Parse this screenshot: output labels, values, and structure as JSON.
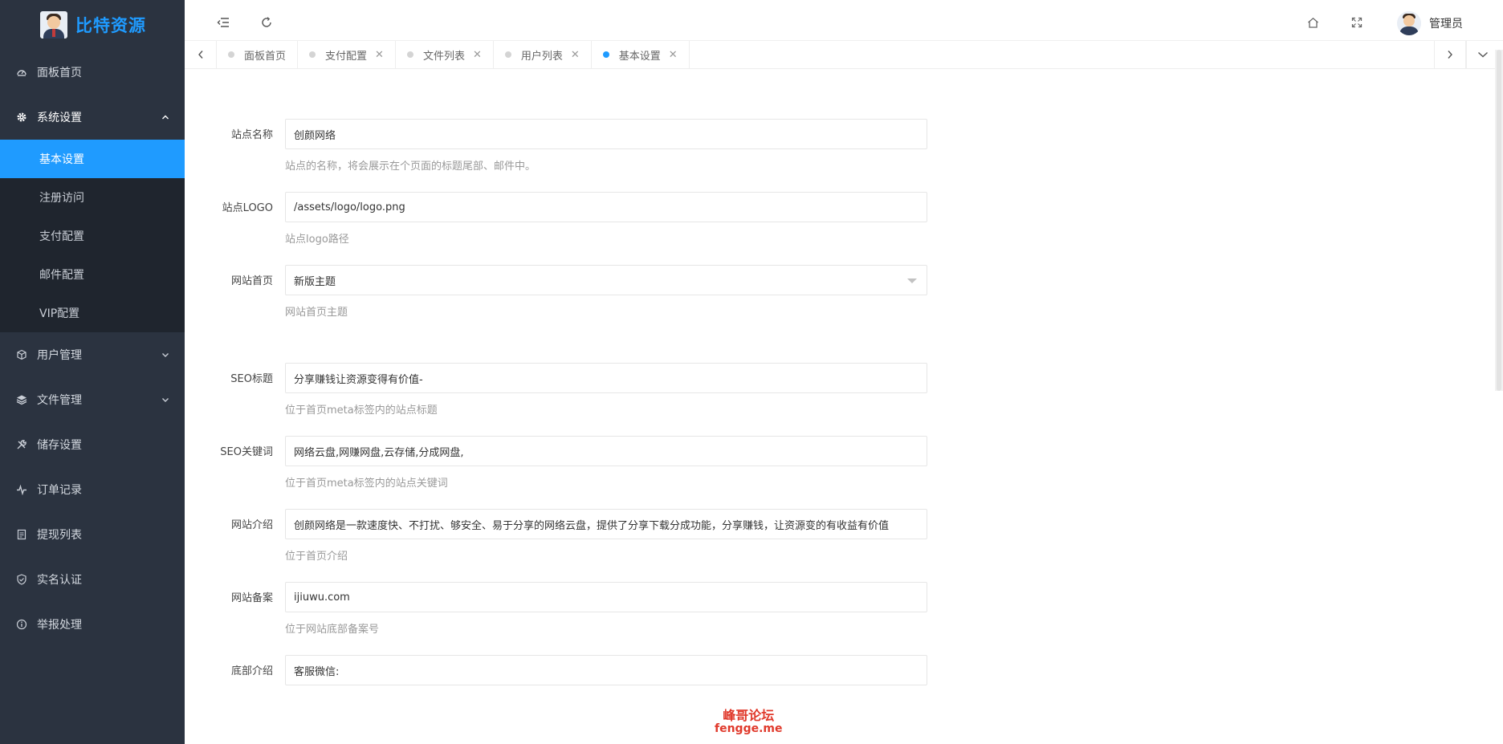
{
  "brand": {
    "name": "比特资源"
  },
  "sidebar": {
    "items": [
      {
        "label": "面板首页",
        "icon": "dashboard-icon"
      },
      {
        "label": "系统设置",
        "icon": "gear-icon",
        "open": true,
        "children": [
          {
            "label": "基本设置",
            "active": true
          },
          {
            "label": "注册访问"
          },
          {
            "label": "支付配置"
          },
          {
            "label": "邮件配置"
          },
          {
            "label": "VIP配置"
          }
        ]
      },
      {
        "label": "用户管理",
        "icon": "cube-icon"
      },
      {
        "label": "文件管理",
        "icon": "layers-icon"
      },
      {
        "label": "储存设置",
        "icon": "tools-icon"
      },
      {
        "label": "订单记录",
        "icon": "pulse-icon"
      },
      {
        "label": "提现列表",
        "icon": "list-icon"
      },
      {
        "label": "实名认证",
        "icon": "shield-check-icon"
      },
      {
        "label": "举报处理",
        "icon": "info-icon"
      }
    ]
  },
  "header": {
    "user_name": "管理员",
    "icons": [
      "menu-fold-icon",
      "refresh-icon",
      "home-icon",
      "fullscreen-icon"
    ]
  },
  "tabs": [
    {
      "label": "面板首页",
      "closable": false
    },
    {
      "label": "支付配置",
      "closable": true
    },
    {
      "label": "文件列表",
      "closable": true
    },
    {
      "label": "用户列表",
      "closable": true
    },
    {
      "label": "基本设置",
      "closable": true,
      "active": true
    }
  ],
  "form": {
    "site_name": {
      "label": "站点名称",
      "value": "创颜网络",
      "help": "站点的名称，将会展示在个页面的标题尾部、邮件中。"
    },
    "site_logo": {
      "label": "站点LOGO",
      "value": "/assets/logo/logo.png",
      "help": "站点logo路径"
    },
    "home_theme": {
      "label": "网站首页",
      "value": "新版主题",
      "help": "网站首页主题"
    },
    "seo_title": {
      "label": "SEO标题",
      "value": "分享赚钱让资源变得有价值-",
      "help": "位于首页meta标签内的站点标题"
    },
    "seo_keywords": {
      "label": "SEO关键词",
      "value": "网络云盘,网赚网盘,云存储,分成网盘,",
      "help": "位于首页meta标签内的站点关键词"
    },
    "site_intro": {
      "label": "网站介绍",
      "value": "创颜网络是一款速度快、不打扰、够安全、易于分享的网络云盘，提供了分享下载分成功能，分享赚钱，让资源变的有收益有价值",
      "help": "位于首页介绍"
    },
    "site_icp": {
      "label": "网站备案",
      "value": "ijiuwu.com",
      "help": "位于网站底部备案号"
    },
    "footer_intro": {
      "label": "底部介绍",
      "value": "客服微信:"
    }
  },
  "watermark": {
    "line1": "峰哥论坛",
    "line2": "fengge.me"
  },
  "colors": {
    "sidebar_bg": "#2b3340",
    "accent": "#1f9bff",
    "submenu_bg": "#1f252e"
  }
}
